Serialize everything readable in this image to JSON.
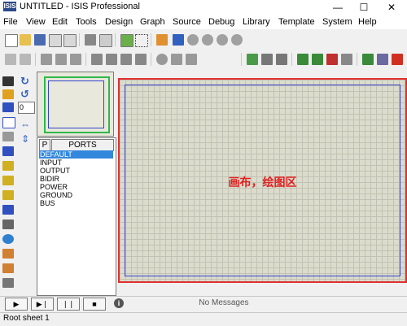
{
  "window": {
    "app_icon": "ISIS",
    "title": "UNTITLED - ISIS Professional",
    "minimize": "—",
    "maximize": "☐",
    "close": "✕"
  },
  "menu": [
    "File",
    "View",
    "Edit",
    "Tools",
    "Design",
    "Graph",
    "Source",
    "Debug",
    "Library",
    "Template",
    "System",
    "Help"
  ],
  "left_panel": {
    "rotation_value": "0",
    "ports_tab": "P",
    "ports_header": "PORTS",
    "ports": [
      "DEFAULT",
      "INPUT",
      "OUTPUT",
      "BIDIR",
      "POWER",
      "GROUND",
      "BUS"
    ],
    "selected_port": "DEFAULT"
  },
  "canvas": {
    "label": "画布，绘图区"
  },
  "status": {
    "message": "No Messages",
    "info_icon": "i",
    "sheet": "Root sheet 1",
    "transport": [
      "▶",
      "▶❘",
      "❘❘",
      "■"
    ]
  },
  "colors": {
    "canvas_bg": "#dcdccd",
    "canvas_border": "#e03030",
    "sheet_border": "#3344cc",
    "selection": "#3388dd"
  }
}
